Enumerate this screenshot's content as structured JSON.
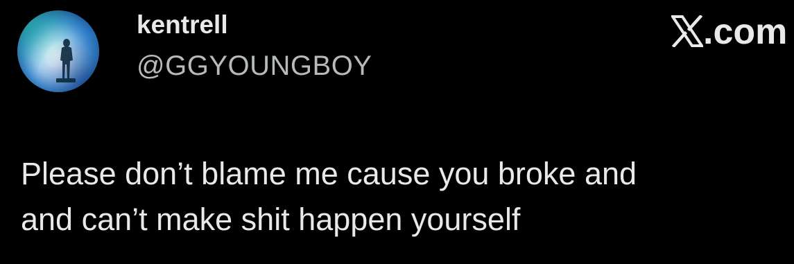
{
  "author": {
    "name": "kentrell",
    "handle": "@GGYOUNGBOY",
    "avatar_icon": "profile-photo"
  },
  "brand": {
    "icon": "x-logo-icon",
    "suffix": ".com"
  },
  "tweet": {
    "text": "Please don’t blame me cause you broke and\nand can’t make shit happen yourself"
  },
  "colors": {
    "background": "#000000",
    "text": "#e7e9ea",
    "handle": "#b6babd"
  }
}
